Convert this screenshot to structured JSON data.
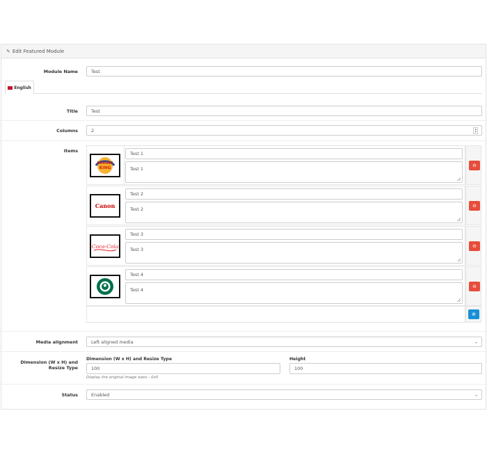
{
  "panel": {
    "heading": "Edit Featured Module"
  },
  "form": {
    "module_name_label": "Module Name",
    "module_name_value": "Test",
    "language_tab": "English",
    "title_label": "Title",
    "title_value": "Test",
    "columns_label": "Columns",
    "columns_value": "2",
    "items_label": "Items",
    "items": [
      {
        "title": "Test 1",
        "description": "Test 1",
        "logo": "BURGER KING"
      },
      {
        "title": "Test 2",
        "description": "Test 2",
        "logo": "Canon"
      },
      {
        "title": "Test 3",
        "description": "Test 3",
        "logo": "Coca-Cola"
      },
      {
        "title": "Test 4",
        "description": "Test 4",
        "logo": "STARBUCKS COFFEE"
      }
    ],
    "media_alignment_label": "Media alignment",
    "media_alignment_value": "Left aligned media",
    "dimension_label": "Dimension (W x H) and Resize Type",
    "dimension_sub_label": "Dimension (W x H) and Resize Type",
    "width_value": "100",
    "help_text": "Display the original image sizes - 0x0",
    "height_label": "Height",
    "height_value": "100",
    "status_label": "Status",
    "status_value": "Enabled"
  },
  "icons": {
    "edit": "pencil-icon",
    "remove": "minus-circle-icon",
    "add": "plus-circle-icon",
    "select": "chevron-down-icon"
  },
  "colors": {
    "danger": "#e74c3c",
    "primary": "#1a8fd6",
    "heading_bg": "#f5f5f5"
  }
}
